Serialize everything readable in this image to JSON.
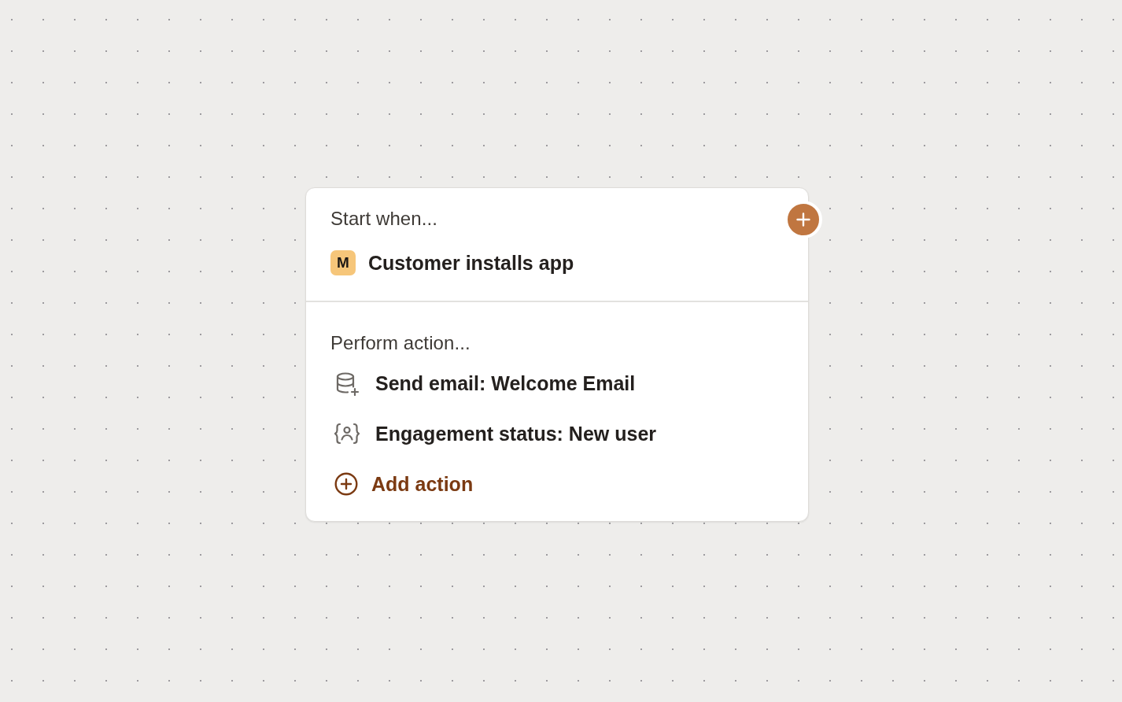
{
  "trigger": {
    "heading": "Start when...",
    "event": {
      "logo_letter": "M",
      "label": "Customer installs app"
    }
  },
  "actions": {
    "heading": "Perform action...",
    "items": [
      {
        "kind": "email",
        "label": "Send email: Welcome Email"
      },
      {
        "kind": "attribute",
        "label": "Engagement status: New user"
      }
    ],
    "add_action": {
      "label": "Add action"
    }
  }
}
